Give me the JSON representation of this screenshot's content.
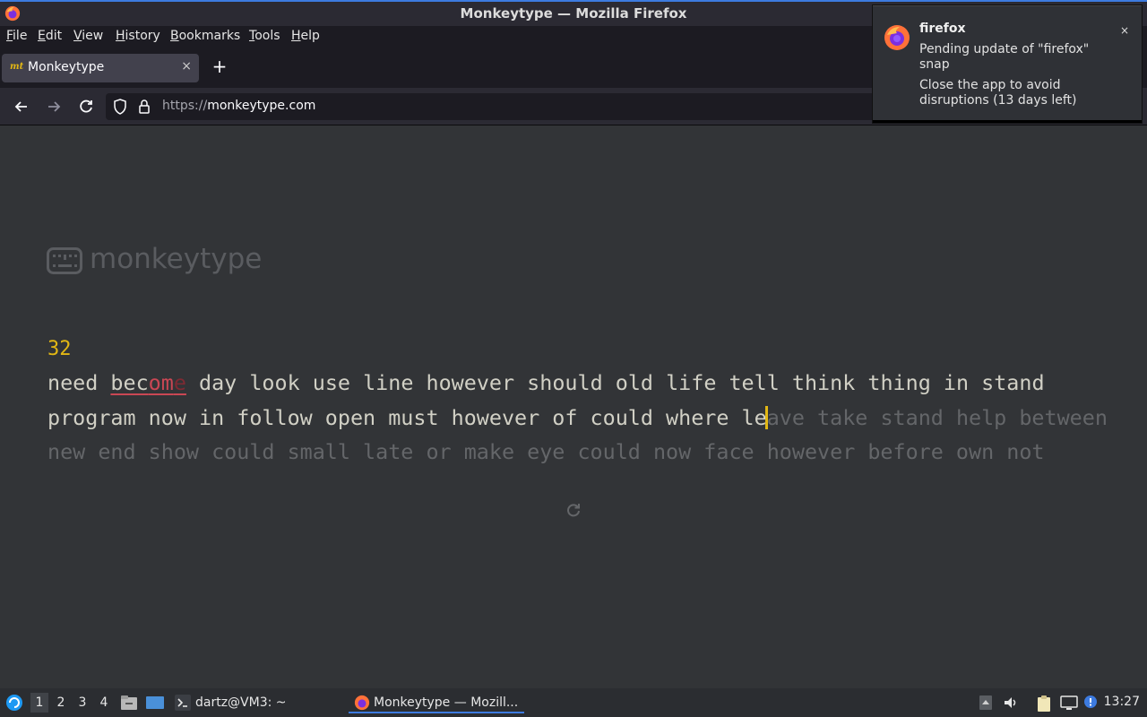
{
  "window": {
    "title": "Monkeytype — Mozilla Firefox"
  },
  "menubar": {
    "items": [
      "File",
      "Edit",
      "View",
      "History",
      "Bookmarks",
      "Tools",
      "Help"
    ]
  },
  "tabs": [
    {
      "label": "Monkeytype",
      "favicon": "mt"
    }
  ],
  "toolbar": {
    "new_tab": "+",
    "close_tab": "×"
  },
  "urlbar": {
    "scheme": "https://",
    "host": "monkeytype.com"
  },
  "page": {
    "logo_text": "monkeytype",
    "word_counter": "32",
    "line1": {
      "w1": "need ",
      "err_typed": "bec",
      "err_wrong": "om",
      "err_missing": "e",
      "rest": " day look use line however should old life tell think thing in stand"
    },
    "line2": {
      "typed": "program now in follow open must however of could where le",
      "untyped": "ave take stand help between"
    },
    "line3": "new end show could small late or make eye could now face however before own not",
    "restart_icon": "refresh-icon"
  },
  "notification": {
    "app": "firefox",
    "body1": "Pending update of \"firefox\" snap",
    "body2": "Close the app to avoid disruptions (13 days left)",
    "close": "×"
  },
  "taskbar": {
    "workspaces": [
      "1",
      "2",
      "3",
      "4"
    ],
    "active_workspace": "1",
    "tasks": [
      "dartz@VM3: ~",
      "Monkeytype — Mozill..."
    ],
    "clock": "13:27"
  },
  "colors": {
    "accent": "#e2b714",
    "error": "#ca4754",
    "text": "#d1d0c5",
    "sub": "#646669",
    "background": "#323437"
  }
}
